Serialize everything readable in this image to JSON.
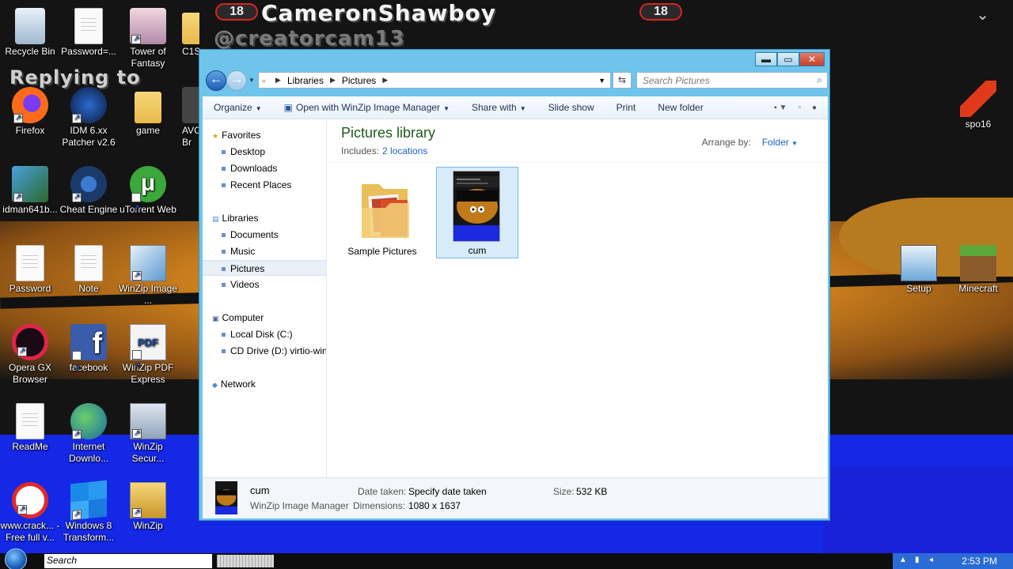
{
  "overlay": {
    "title": "CameronShawboy",
    "badge": "18",
    "handle": "@creatorcam13",
    "reply": "Replying to"
  },
  "desktop_icons": [
    {
      "label": "Recycle Bin",
      "icon": "recycle-bin-icon"
    },
    {
      "label": "Password=...",
      "icon": "document-icon"
    },
    {
      "label": "Tower of Fantasy",
      "icon": "game-icon"
    },
    {
      "label": "C1S",
      "icon": "folder-icon"
    },
    {
      "label": "Firefox",
      "icon": "firefox-icon"
    },
    {
      "label": "IDM 6.xx Patcher v2.6",
      "icon": "patcher-icon"
    },
    {
      "label": "game",
      "icon": "folder-icon"
    },
    {
      "label": "AVC Br",
      "icon": "app-icon"
    },
    {
      "label": "idman641b...",
      "icon": "installer-icon"
    },
    {
      "label": "Cheat Engine",
      "icon": "cheat-engine-icon"
    },
    {
      "label": "uTorrent Web",
      "icon": "utorrent-icon"
    },
    {
      "label": "Password",
      "icon": "document-icon"
    },
    {
      "label": "Note",
      "icon": "document-icon"
    },
    {
      "label": "WinZip Image ...",
      "icon": "winzip-image-icon"
    },
    {
      "label": "Opera GX Browser",
      "icon": "opera-gx-icon"
    },
    {
      "label": "facebook",
      "icon": "facebook-icon"
    },
    {
      "label": "WinZip PDF Express",
      "icon": "winzip-pdf-icon"
    },
    {
      "label": "ReadMe",
      "icon": "document-icon"
    },
    {
      "label": "Internet Downlo...",
      "icon": "idm-icon"
    },
    {
      "label": "WinZip Secur...",
      "icon": "winzip-secure-icon"
    },
    {
      "label": "www.crack... - Free full v...",
      "icon": "web-shortcut-icon"
    },
    {
      "label": "Windows 8 Transform...",
      "icon": "windows-icon"
    },
    {
      "label": "WinZip",
      "icon": "winzip-icon"
    },
    {
      "label": "spo16",
      "icon": "spo16-icon"
    },
    {
      "label": "Setup",
      "icon": "setup-icon"
    },
    {
      "label": "Minecraft",
      "icon": "minecraft-icon"
    }
  ],
  "window": {
    "address": {
      "root": "Libraries",
      "current": "Pictures"
    },
    "search_placeholder": "Search Pictures",
    "toolbar": {
      "organize": "Organize",
      "open_with": "Open with WinZip Image Manager",
      "share_with": "Share with",
      "slide_show": "Slide show",
      "print": "Print",
      "new_folder": "New folder"
    },
    "nav": {
      "favorites": "Favorites",
      "desktop": "Desktop",
      "downloads": "Downloads",
      "recent": "Recent Places",
      "libraries": "Libraries",
      "documents": "Documents",
      "music": "Music",
      "pictures": "Pictures",
      "videos": "Videos",
      "computer": "Computer",
      "local_disk": "Local Disk (C:)",
      "cd_drive": "CD Drive (D:) virtio-win",
      "network": "Network"
    },
    "library": {
      "title": "Pictures library",
      "includes_label": "Includes:",
      "includes_link": "2 locations",
      "arrange_label": "Arrange by:",
      "arrange_value": "Folder"
    },
    "items": [
      {
        "name": "Sample Pictures",
        "kind": "folder"
      },
      {
        "name": "cum",
        "kind": "image",
        "selected": true
      }
    ],
    "details": {
      "name": "cum",
      "type": "WinZip Image Manager",
      "date_taken_label": "Date taken:",
      "date_taken_value": "Specify date taken",
      "dimensions_label": "Dimensions:",
      "dimensions_value": "1080 x 1637",
      "size_label": "Size:",
      "size_value": "532 KB"
    }
  },
  "taskbar": {
    "search": "Search",
    "clock": "2:53 PM"
  },
  "colors": {
    "window_frame": "#6ec4ea",
    "library_title": "#1e5a1e",
    "link": "#1c63c4",
    "selection": "#d7ebfb",
    "tray": "#2a6bd6"
  }
}
